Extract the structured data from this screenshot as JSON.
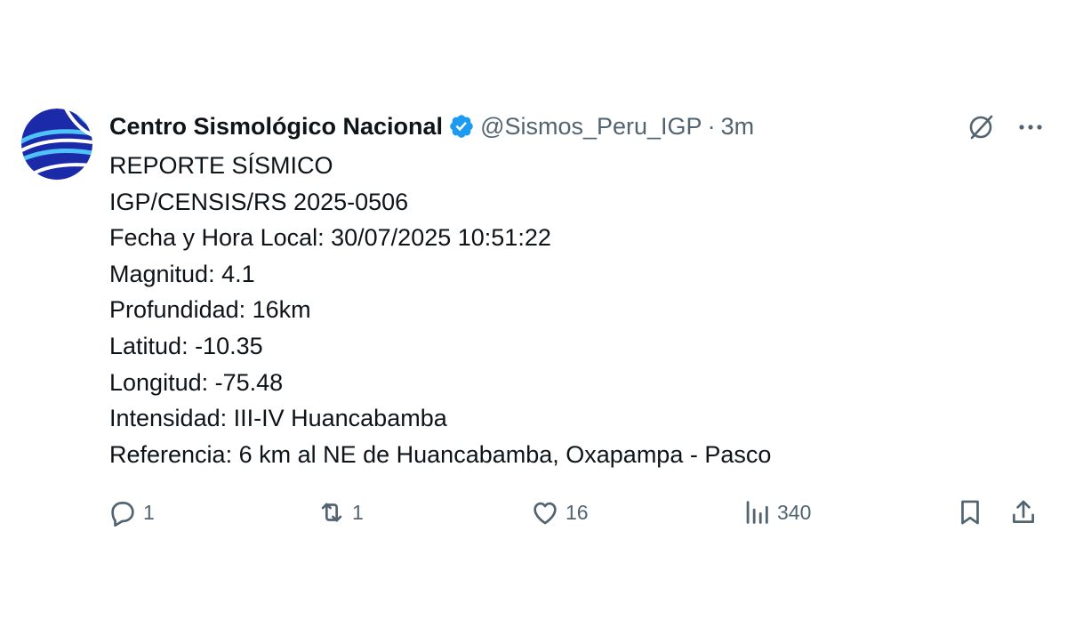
{
  "tweet": {
    "display_name": "Centro Sismológico Nacional",
    "handle": "@Sismos_Peru_IGP",
    "separator": "·",
    "time": "3m",
    "lines": [
      "REPORTE SÍSMICO",
      "IGP/CENSIS/RS 2025-0506",
      "Fecha y Hora Local: 30/07/2025 10:51:22",
      "Magnitud: 4.1",
      "Profundidad: 16km",
      "Latitud: -10.35",
      "Longitud: -75.48",
      "Intensidad: III-IV Huancabamba",
      "Referencia: 6 km al NE de Huancabamba, Oxapampa - Pasco"
    ]
  },
  "actions": {
    "replies": "1",
    "reposts": "1",
    "likes": "16",
    "views": "340"
  },
  "icons": {
    "verified": "verified-badge-icon",
    "grok": "grok-icon",
    "more": "more-icon",
    "reply": "reply-icon",
    "repost": "repost-icon",
    "like": "heart-icon",
    "views": "views-icon",
    "bookmark": "bookmark-icon",
    "share": "share-icon"
  },
  "colors": {
    "text": "#0f1419",
    "secondary": "#536471",
    "verified": "#1d9bf0",
    "avatar_bg": "#1a2aa8",
    "avatar_accent": "#4fc3f7"
  }
}
